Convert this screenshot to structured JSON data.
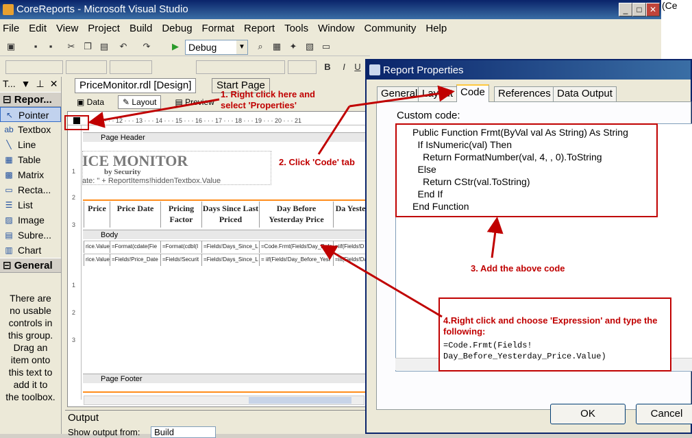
{
  "window": {
    "title": "CoreReports - Microsoft Visual Studio"
  },
  "menu": [
    "File",
    "Edit",
    "View",
    "Project",
    "Build",
    "Debug",
    "Format",
    "Report",
    "Tools",
    "Window",
    "Community",
    "Help"
  ],
  "toolbar": {
    "config": "Debug"
  },
  "toolbox": {
    "title": "T...",
    "section_reporting": "Repor...",
    "items": [
      "Pointer",
      "Textbox",
      "Line",
      "Table",
      "Matrix",
      "Recta...",
      "List",
      "Image",
      "Subre...",
      "Chart"
    ],
    "section_general": "General",
    "empty_message": "There are no usable controls in this group. Drag an item onto this text to add it to the toolbox."
  },
  "document": {
    "tab_active": "PriceMonitor.rdl [Design]",
    "tab_other": "Start Page",
    "subtabs": [
      "Data",
      "Layout",
      "Preview"
    ],
    "ruler_marks": "1 · · · 12 · · · 13 · · · 14 · · · 15 · · · 16 · · · 17 · · · 18 · · · 19 · · · 20 · · · 21",
    "page_header": "Page Header",
    "report_title": "ICE MONITOR",
    "report_subtitle": "by Security",
    "report_date_expr": "ate: \" + ReportItems!hiddenTextbox.Value",
    "columns": [
      "Price",
      "Price Date",
      "Pricing Factor",
      "Days Since Last Priced",
      "Day Before Yesterday Price",
      "Da Yeste"
    ],
    "body_label": "Body",
    "row1": [
      "rice.Value",
      "=Format(cdate(Fie",
      "=Format(cdbl(I",
      "=Fields!Days_Since_L",
      "=Code.Frmt(Fields!Day_Befo",
      "=iif(Fields!D"
    ],
    "row2": [
      "rice.Value",
      "=Fields!Price_Date",
      "=Fields!Securit",
      "=Fields!Days_Since_L",
      "= iif(Fields!Day_Before_Yest",
      "=iif(Fields!Day_"
    ],
    "page_footer": "Page Footer"
  },
  "output": {
    "title": "Output",
    "show_from": "Show output from:",
    "source": "Build"
  },
  "dialog": {
    "title": "Report Properties",
    "tabs": [
      "General",
      "Layout",
      "Code",
      "References",
      "Data Output"
    ],
    "active_tab": "Code",
    "custom_code_label": "Custom code:",
    "code_lines": [
      "Public Function Frmt(ByVal val As String) As String",
      "    If IsNumeric(val) Then",
      "        Return FormatNumber(val, 4, , 0).ToString",
      "    Else",
      "        Return CStr(val.ToString)",
      "    End If",
      "End Function"
    ],
    "ok": "OK",
    "cancel": "Cancel"
  },
  "annotations": {
    "step1": "1. Right click here and select 'Properties'",
    "step2": "2. Click 'Code' tab",
    "step3": "3. Add the above code",
    "step4": "4.Right click and choose 'Expression' and type the following:",
    "step4_code": "=Code.Frmt(Fields!\nDay_Before_Yesterday_Price.Value)"
  },
  "colors": {
    "annotation": "#c00000",
    "title_bar": "#0a246a",
    "orange_rule": "#ff8c1a"
  }
}
